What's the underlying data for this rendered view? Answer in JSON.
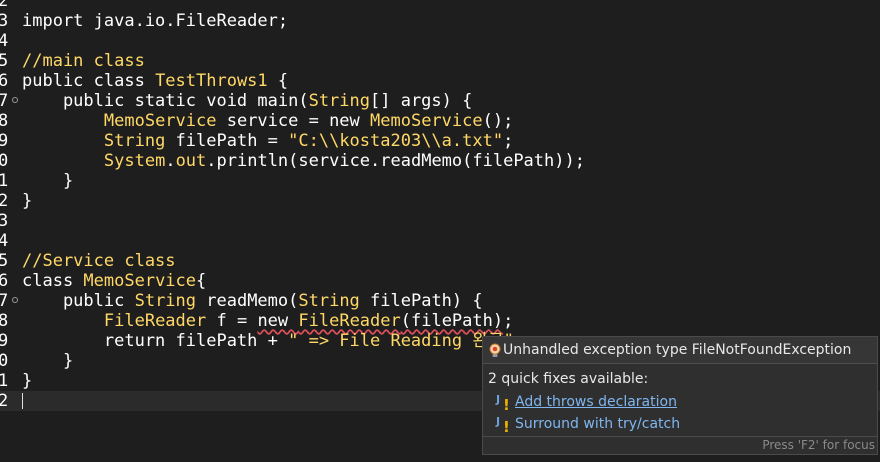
{
  "editor": {
    "lines": [
      {
        "num": "2",
        "segments": []
      },
      {
        "num": "3",
        "segments": [
          {
            "t": "import java.io.FileReader;",
            "c": "kw"
          }
        ]
      },
      {
        "num": "4",
        "segments": []
      },
      {
        "num": "5",
        "segments": [
          {
            "t": "//main class",
            "c": "cm"
          }
        ]
      },
      {
        "num": "6",
        "segments": [
          {
            "t": "public class ",
            "c": "kw"
          },
          {
            "t": "TestThrows1",
            "c": "cls"
          },
          {
            "t": " {",
            "c": "kw"
          }
        ]
      },
      {
        "num": "7",
        "fold": true,
        "segments": [
          {
            "t": "    public static void main(",
            "c": "kw"
          },
          {
            "t": "String",
            "c": "ty"
          },
          {
            "t": "[] args) {",
            "c": "kw"
          }
        ]
      },
      {
        "num": "8",
        "segments": [
          {
            "t": "        ",
            "c": "kw"
          },
          {
            "t": "MemoService",
            "c": "ty"
          },
          {
            "t": " service = new ",
            "c": "kw"
          },
          {
            "t": "MemoService",
            "c": "ty"
          },
          {
            "t": "();",
            "c": "kw"
          }
        ]
      },
      {
        "num": "9",
        "segments": [
          {
            "t": "        ",
            "c": "kw"
          },
          {
            "t": "String",
            "c": "ty"
          },
          {
            "t": " filePath = ",
            "c": "kw"
          },
          {
            "t": "\"C:\\\\kosta203\\\\a.txt\"",
            "c": "str"
          },
          {
            "t": ";",
            "c": "kw"
          }
        ]
      },
      {
        "num": "0",
        "segments": [
          {
            "t": "        ",
            "c": "kw"
          },
          {
            "t": "System",
            "c": "ty"
          },
          {
            "t": ".",
            "c": "kw"
          },
          {
            "t": "out",
            "c": "fld"
          },
          {
            "t": ".println(service.readMemo(filePath));",
            "c": "kw"
          }
        ]
      },
      {
        "num": "1",
        "segments": [
          {
            "t": "    }",
            "c": "kw"
          }
        ]
      },
      {
        "num": "2",
        "segments": [
          {
            "t": "}",
            "c": "kw"
          }
        ]
      },
      {
        "num": "3",
        "segments": []
      },
      {
        "num": "4",
        "segments": []
      },
      {
        "num": "5",
        "segments": [
          {
            "t": "//Service class",
            "c": "cm"
          }
        ]
      },
      {
        "num": "6",
        "segments": [
          {
            "t": "class ",
            "c": "kw"
          },
          {
            "t": "MemoService",
            "c": "cls"
          },
          {
            "t": "{",
            "c": "kw"
          }
        ]
      },
      {
        "num": "7",
        "fold": true,
        "segments": [
          {
            "t": "    public ",
            "c": "kw"
          },
          {
            "t": "String",
            "c": "ty"
          },
          {
            "t": " readMemo(",
            "c": "kw"
          },
          {
            "t": "String",
            "c": "ty"
          },
          {
            "t": " filePath) {",
            "c": "kw"
          }
        ]
      },
      {
        "num": "8",
        "segments": [
          {
            "t": "        ",
            "c": "kw"
          },
          {
            "t": "FileReader",
            "c": "ty"
          },
          {
            "t": " f = ",
            "c": "kw"
          },
          {
            "t": "new ",
            "c": "kw err"
          },
          {
            "t": "FileReader",
            "c": "ty err"
          },
          {
            "t": "(filePath)",
            "c": "kw err"
          },
          {
            "t": ";",
            "c": "kw"
          }
        ]
      },
      {
        "num": "9",
        "segments": [
          {
            "t": "        return filePath + ",
            "c": "kw"
          },
          {
            "t": "\" => File Reading 완료\"",
            "c": "str"
          }
        ]
      },
      {
        "num": "0",
        "segments": [
          {
            "t": "    }",
            "c": "kw"
          }
        ]
      },
      {
        "num": "1",
        "segments": [
          {
            "t": "}",
            "c": "kw"
          }
        ]
      },
      {
        "num": "2",
        "current": true,
        "segments": []
      }
    ]
  },
  "popup": {
    "message": "Unhandled exception type FileNotFoundException",
    "fixes_count": "2 quick fixes available:",
    "fixes": [
      "Add throws declaration",
      "Surround with try/catch"
    ],
    "hint": "Press 'F2' for focus",
    "icon": "lightbulb-error-icon",
    "fix_icon": "java-quickfix-icon"
  },
  "colors": {
    "background": "#1e1e1e",
    "keyword": "#ffffff",
    "type": "#ffd866",
    "link": "#7fb6f0",
    "error_underline": "#e0505a"
  }
}
